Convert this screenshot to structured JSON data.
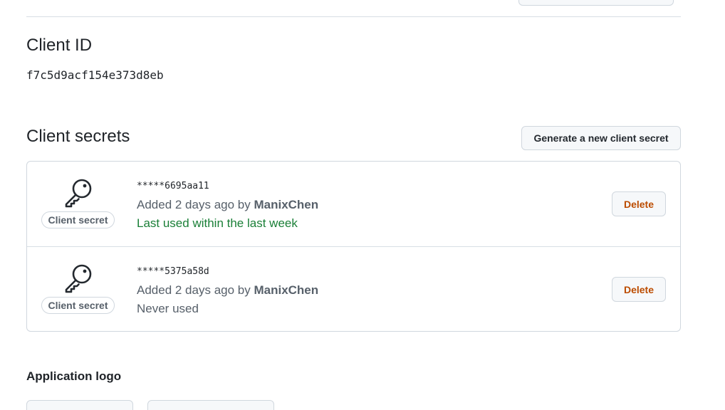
{
  "client_id": {
    "heading": "Client ID",
    "value": "f7c5d9acf154e373d8eb"
  },
  "client_secrets": {
    "heading": "Client secrets",
    "generate_button_label": "Generate a new client secret",
    "secrets": [
      {
        "badge_label": "Client secret",
        "masked_value": "*****6695aa11",
        "added_prefix": "Added 2 days ago by ",
        "author": "ManixChen",
        "usage": "Last used within the last week",
        "usage_status": "recent",
        "delete_label": "Delete",
        "icon": "key-icon"
      },
      {
        "badge_label": "Client secret",
        "masked_value": "*****5375a58d",
        "added_prefix": "Added 2 days ago by ",
        "author": "ManixChen",
        "usage": "Never used",
        "usage_status": "never",
        "delete_label": "Delete",
        "icon": "key-icon"
      }
    ]
  },
  "application_logo": {
    "heading": "Application logo"
  },
  "colors": {
    "accent_green": "#1a7f37",
    "danger_orange": "#bc4c00",
    "muted_text": "#57606a",
    "border": "#d0d7de"
  }
}
